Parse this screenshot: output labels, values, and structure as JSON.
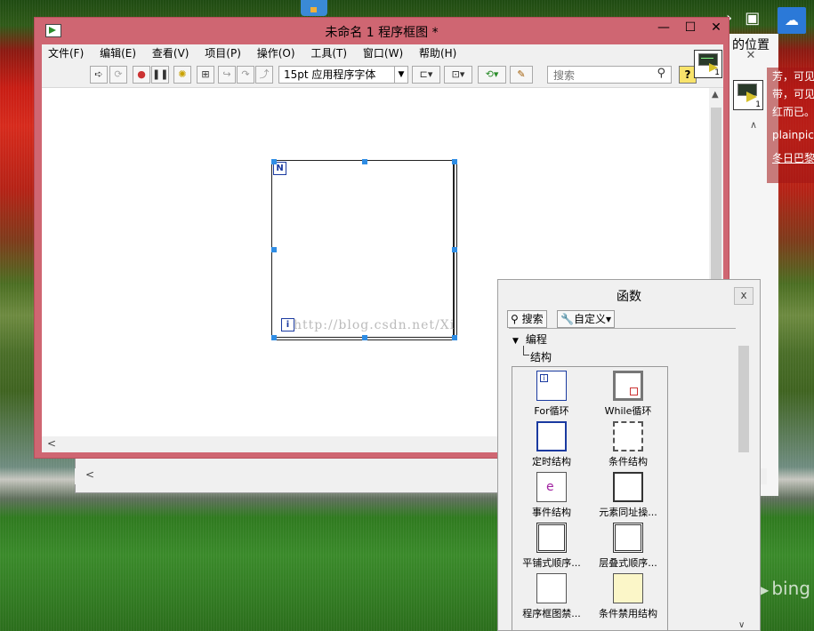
{
  "block_diagram": {
    "title": "未命名 1 程序框图 *",
    "window_controls": {
      "minimize": "—",
      "maximize": "☐",
      "close": "✕"
    },
    "menu": [
      "文件(F)",
      "编辑(E)",
      "查看(V)",
      "项目(P)",
      "操作(O)",
      "工具(T)",
      "窗口(W)",
      "帮助(H)"
    ],
    "toolbar": {
      "font": "15pt 应用程序字体",
      "search_placeholder": "搜索",
      "help": "?"
    },
    "vi_icon_number": "1",
    "for_loop": {
      "count_terminal": "N",
      "iteration_terminal": "i"
    },
    "watermark": "http://blog.csdn.net/Xi"
  },
  "background_window": {
    "vi_icon_number": "1",
    "hscroll_left": "<",
    "sidebar_lines": [
      "芳，可见",
      "带，可见",
      "红而已。",
      "plainpictu",
      "冬日巴黎"
    ],
    "title_fragment": "的位置"
  },
  "functions_palette": {
    "title": "函数",
    "close": "x",
    "search_button": "搜索",
    "customize_button": "自定义",
    "tree": {
      "level1": "编程",
      "level2": "结构"
    },
    "items": [
      {
        "label": "For循环",
        "icon": "for-loop-icon"
      },
      {
        "label": "While循环",
        "icon": "while-loop-icon"
      },
      {
        "label": "定时结构",
        "icon": "timed-structure-icon"
      },
      {
        "label": "条件结构",
        "icon": "case-structure-icon"
      },
      {
        "label": "事件结构",
        "icon": "event-structure-icon"
      },
      {
        "label": "元素同址操...",
        "icon": "in-place-element-icon"
      },
      {
        "label": "平铺式顺序...",
        "icon": "flat-sequence-icon"
      },
      {
        "label": "层叠式顺序...",
        "icon": "stacked-sequence-icon"
      },
      {
        "label": "程序框图禁...",
        "icon": "diagram-disable-icon"
      },
      {
        "label": "条件禁用结构",
        "icon": "conditional-disable-icon"
      }
    ]
  },
  "desktop": {
    "watermark": "bing"
  }
}
